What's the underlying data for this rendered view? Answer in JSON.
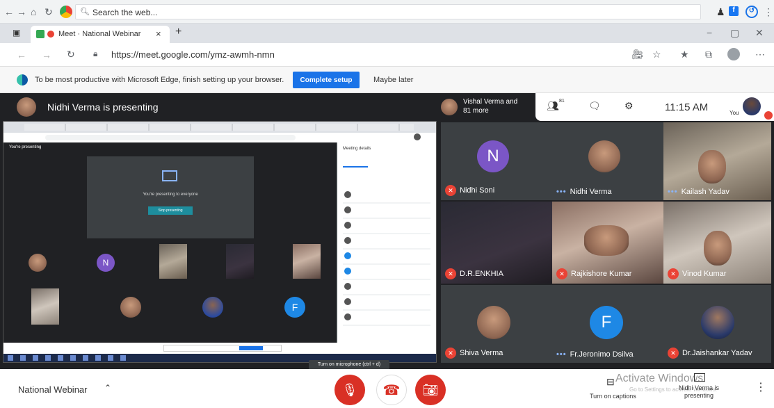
{
  "browser": {
    "search_placeholder": "Search the web...",
    "tab_title": "Meet · National Webinar",
    "url": "https://meet.google.com/ymz-awmh-nmn"
  },
  "infobar": {
    "message": "To be most productive with Microsoft Edge, finish setting up your browser.",
    "complete_label": "Complete setup",
    "maybe_label": "Maybe later"
  },
  "presentation": {
    "header": "Nidhi Verma is presenting",
    "inner_label": "You're presenting",
    "inner_center": "You're presenting to everyone",
    "inner_stop": "Stop presenting",
    "panel_title": "Meeting details"
  },
  "meet_header": {
    "stack_label": "Vishal Verma and 81 more",
    "people_count": "81",
    "time": "11:15 AM",
    "you_label": "You"
  },
  "participants": [
    {
      "name": "Nidhi Soni",
      "initial": "N",
      "mic": "off"
    },
    {
      "name": "Nidhi Verma",
      "mic": "speaking"
    },
    {
      "name": "Kailash Yadav",
      "mic": "speaking"
    },
    {
      "name": "D.R.ENKHIA",
      "mic": "off"
    },
    {
      "name": "Rajkishore Kumar",
      "mic": "off"
    },
    {
      "name": "Vinod Kumar",
      "mic": "off"
    },
    {
      "name": "Shiva Verma",
      "mic": "off"
    },
    {
      "name": "Fr.Jeronimo Dsilva",
      "initial": "F",
      "mic": "speaking"
    },
    {
      "name": "Dr.Jaishankar Yadav",
      "mic": "off"
    }
  ],
  "bottom": {
    "meeting_name": "National Webinar",
    "tooltip": "Turn on microphone (ctrl + d)",
    "captions_label": "Turn on captions",
    "presenting_label": "Nidhi Verma is presenting",
    "watermark": "Activate Windows",
    "watermark_sub": "Go to Settings to activate Windows."
  },
  "colors": {
    "meet_bg": "#202124",
    "tile_bg": "#3c4043",
    "mic_off": "#ea4335",
    "speaking": "#8ab4f8",
    "avatar_purple": "#7b56c6",
    "avatar_blue": "#1e88e5",
    "edge_blue": "#1a73e8"
  }
}
